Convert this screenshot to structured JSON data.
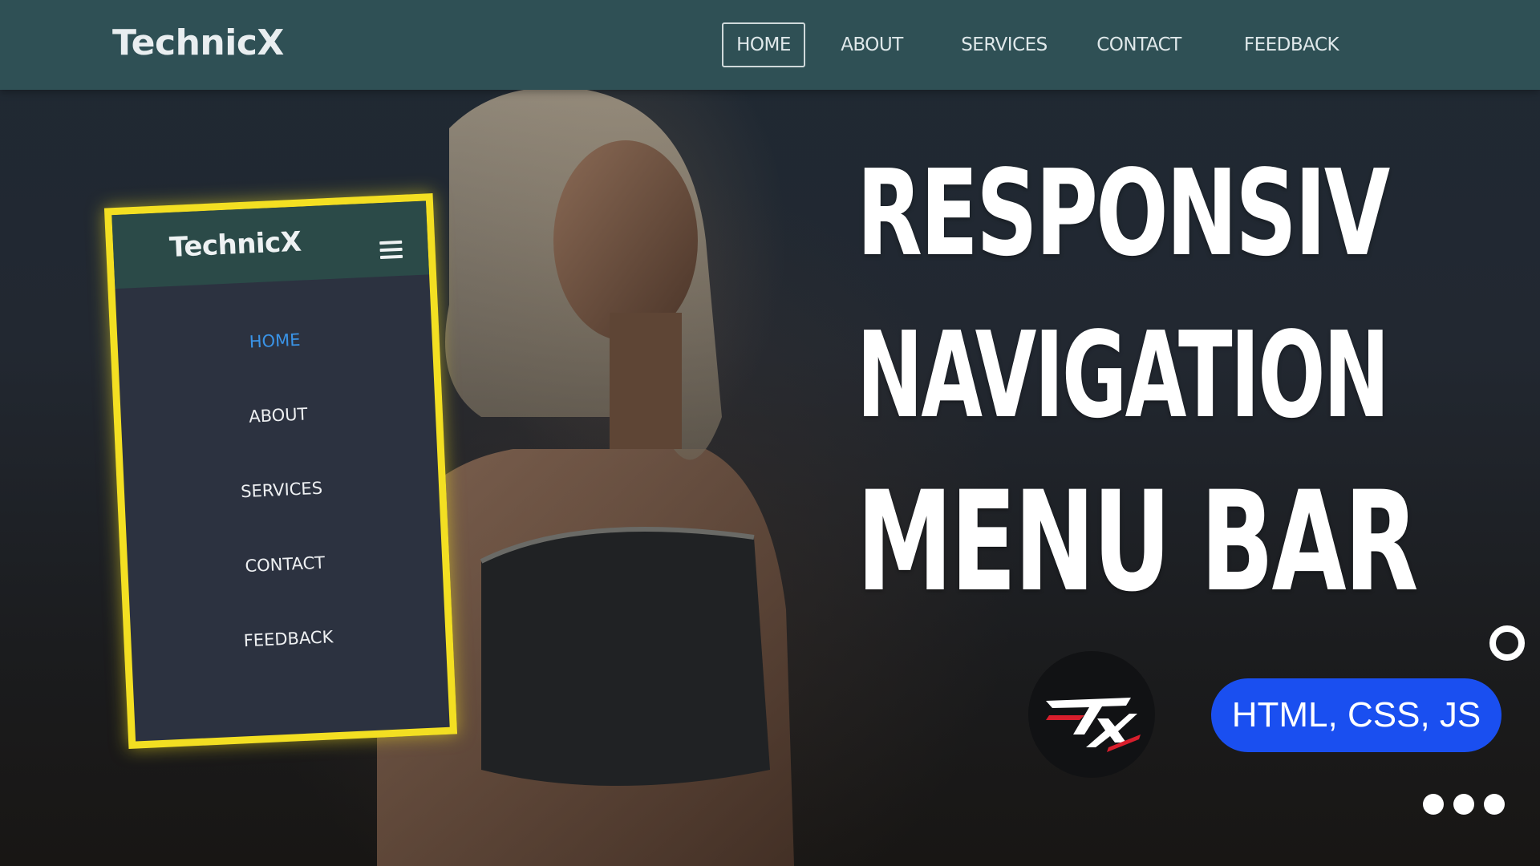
{
  "navbar": {
    "brand": "TechnicX",
    "links": [
      {
        "label": "HOME",
        "active": true
      },
      {
        "label": "ABOUT",
        "active": false
      },
      {
        "label": "SERVICES",
        "active": false
      },
      {
        "label": "CONTACT",
        "active": false
      },
      {
        "label": "FEEDBACK",
        "active": false
      }
    ]
  },
  "mobile_preview": {
    "brand": "TechnicX",
    "menu_icon": "hamburger-icon",
    "items": [
      {
        "label": "HOME",
        "active": true
      },
      {
        "label": "ABOUT",
        "active": false
      },
      {
        "label": "SERVICES",
        "active": false
      },
      {
        "label": "CONTACT",
        "active": false
      },
      {
        "label": "FEEDBACK",
        "active": false
      }
    ]
  },
  "headline": {
    "line1": "RESPONSIV",
    "line2": "NAVIGATION",
    "line3": "MENU BAR"
  },
  "logo_icon": "tx-logo-icon",
  "tech_badge": "HTML, CSS, JS",
  "colors": {
    "navbar": "#2f5055",
    "mobile_border": "#f3df22",
    "mobile_active": "#3a93e6",
    "badge": "#1a4ff0"
  }
}
